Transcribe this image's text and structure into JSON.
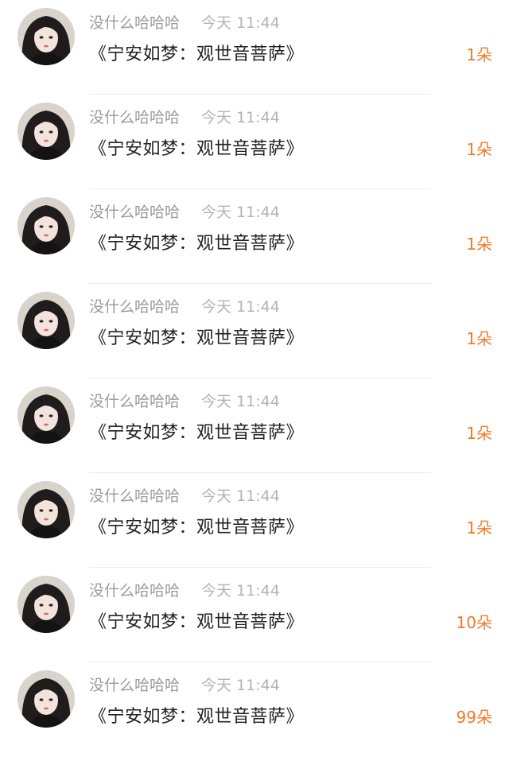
{
  "gift_list": {
    "items": [
      {
        "username": "没什么哈哈哈",
        "time": "今天 11:44",
        "gift_name": "《宁安如梦：观世音菩萨》",
        "count": "1朵",
        "avatar": "avatar-icon"
      },
      {
        "username": "没什么哈哈哈",
        "time": "今天 11:44",
        "gift_name": "《宁安如梦：观世音菩萨》",
        "count": "1朵",
        "avatar": "avatar-icon"
      },
      {
        "username": "没什么哈哈哈",
        "time": "今天 11:44",
        "gift_name": "《宁安如梦：观世音菩萨》",
        "count": "1朵",
        "avatar": "avatar-icon"
      },
      {
        "username": "没什么哈哈哈",
        "time": "今天 11:44",
        "gift_name": "《宁安如梦：观世音菩萨》",
        "count": "1朵",
        "avatar": "avatar-icon"
      },
      {
        "username": "没什么哈哈哈",
        "time": "今天 11:44",
        "gift_name": "《宁安如梦：观世音菩萨》",
        "count": "1朵",
        "avatar": "avatar-icon"
      },
      {
        "username": "没什么哈哈哈",
        "time": "今天 11:44",
        "gift_name": "《宁安如梦：观世音菩萨》",
        "count": "1朵",
        "avatar": "avatar-icon"
      },
      {
        "username": "没什么哈哈哈",
        "time": "今天 11:44",
        "gift_name": "《宁安如梦：观世音菩萨》",
        "count": "10朵",
        "avatar": "avatar-icon"
      },
      {
        "username": "没什么哈哈哈",
        "time": "今天 11:44",
        "gift_name": "《宁安如梦：观世音菩萨》",
        "count": "99朵",
        "avatar": "avatar-icon"
      }
    ]
  },
  "colors": {
    "username": "#9a9a9a",
    "time": "#b3b3b3",
    "title": "#222222",
    "count_accent": "#f07a2a",
    "divider": "#ececec"
  }
}
